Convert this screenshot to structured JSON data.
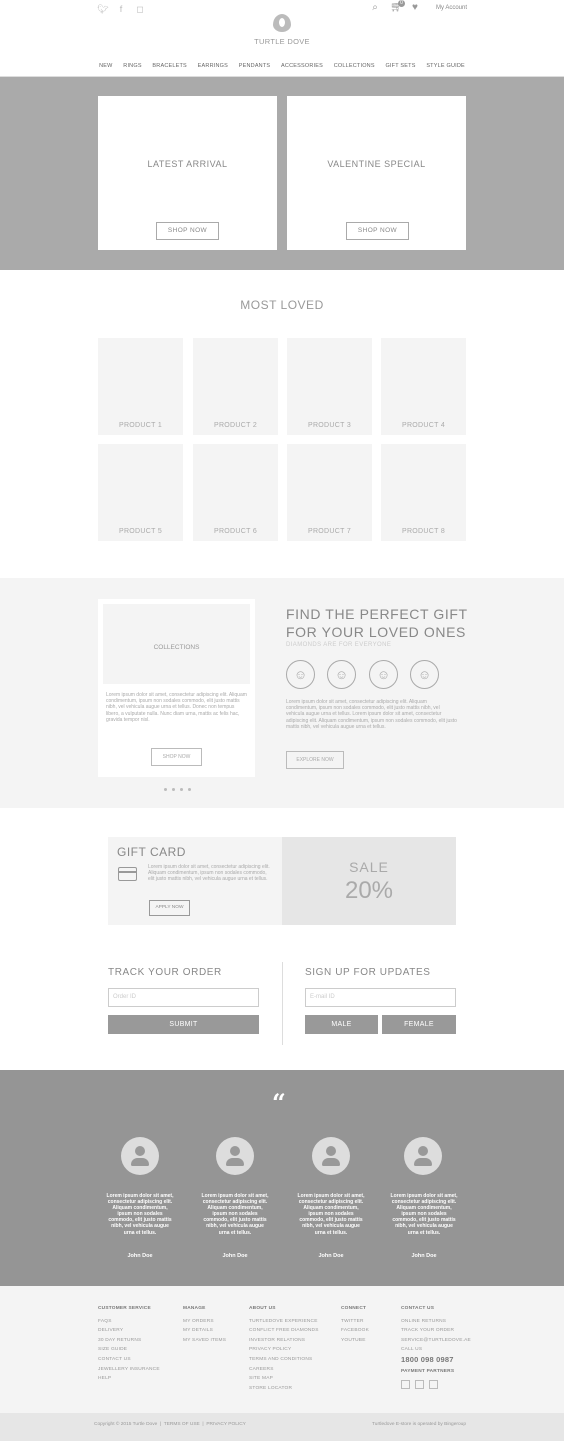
{
  "header": {
    "social": [
      "twitter-icon",
      "facebook-icon",
      "instagram-icon"
    ],
    "cart_count": "0",
    "my_account": "My Account",
    "brand": "TURTLE DOVE"
  },
  "nav": [
    "NEW",
    "RINGS",
    "BRACELETS",
    "EARRINGS",
    "PENDANTS",
    "ACCESSORIES",
    "COLLECTIONS",
    "GIFT SETS",
    "STYLE GUIDE"
  ],
  "hero": {
    "left": {
      "title": "LATEST ARRIVAL",
      "button": "SHOP NOW"
    },
    "right": {
      "title": "VALENTINE SPECIAL",
      "button": "SHOP NOW"
    }
  },
  "most_loved": {
    "title": "MOST LOVED",
    "products": [
      "PRODUCT 1",
      "PRODUCT 2",
      "PRODUCT 3",
      "PRODUCT 4",
      "PRODUCT 5",
      "PRODUCT 6",
      "PRODUCT 7",
      "PRODUCT 8"
    ]
  },
  "collections_card": {
    "label": "COLLECTIONS",
    "text": "Lorem ipsum dolor sit amet, consectetur adipiscing elit. Aliquam condimentum, ipsum non sodales commodo, elit justo mattis nibh, vel vehicula augue urna et tellus. Donec non tempus libero, a vulputate nulla. Nunc diam urna, mattis ac felis hac, gravida tempor nisl.",
    "button": "SHOP NOW"
  },
  "gift_finder": {
    "title_line1": "FIND THE PERFECT GIFT",
    "title_line2": "FOR YOUR LOVED ONES",
    "subtitle": "DIAMONDS ARE FOR EVERYONE",
    "text": "Lorem ipsum dolor sit amet, consectetur adipiscing elit. Aliquam condimentum, ipsum non sodales commodo, elit justo mattis nibh, vel vehicula augue urna et tellus. Lorem ipsum dolor sit amet, consectetur adipiscing elit. Aliquam condimentum, ipsum non sodales commodo, elit justo mattis nibh, vel vehicula augue urna et tellus.",
    "button": "EXPLORE NOW"
  },
  "gift_card": {
    "title": "GIFT CARD",
    "text": "Lorem ipsum dolor sit amet, consectetur adipiscing elit. Aliquam condimentum, ipsum non sodales commodo, elit justo mattis nibh, vel vehicula augue urna et tellus.",
    "button": "APPLY NOW"
  },
  "sale": {
    "label": "SALE",
    "value": "20%"
  },
  "track": {
    "title": "TRACK YOUR ORDER",
    "placeholder": "Order ID",
    "button": "SUBMIT"
  },
  "signup": {
    "title": "SIGN UP FOR UPDATES",
    "placeholder": "E-mail ID",
    "male": "MALE",
    "female": "FEMALE"
  },
  "testimonials": {
    "text": "Lorem ipsum dolor sit amet, consectetur adipiscing elit. Aliquam condimentum, ipsum non sodales commodo, elit justo mattis nibh, vel vehicula augue urna et tellus.",
    "name": "John Doe"
  },
  "footer": {
    "customer_service": {
      "title": "CUSTOMER SERVICE",
      "items": [
        "FAQS",
        "DELIVERY",
        "30 DAY RETURNS",
        "SIZE GUIDE",
        "CONTACT US",
        "JEWELLERY INSURANCE",
        "HELP"
      ]
    },
    "manage": {
      "title": "MANAGE",
      "items": [
        "MY ORDERS",
        "MY DETAILS",
        "MY SAVED ITEMS"
      ]
    },
    "about": {
      "title": "ABOUT US",
      "items": [
        "TURTLEDOVE EXPERIENCE",
        "CONFLICT FREE DIAMONDS",
        "INVESTOR RELATIONS",
        "PRIVACY POLICY",
        "TERMS AND CONDITIONS",
        "CAREERS",
        "SITE MAP",
        "STORE LOCATOR"
      ]
    },
    "connect": {
      "title": "CONNECT",
      "items": [
        "TWITTER",
        "FACEBOOK",
        "YOUTUBE"
      ]
    },
    "contact": {
      "title": "CONTACT US",
      "items": [
        "ONLINE RETURNS",
        "TRACK YOUR ORDER",
        "SERVICE@TURTLEDOVE.AE",
        "CALL US"
      ],
      "phone": "1800 098 0987",
      "payment": "PAYMENT PARTNERS"
    },
    "copyright": "Copyright © 2015 Turtle Dove",
    "terms": "TERMS OF USE",
    "privacy": "PRIVACY POLICY",
    "operated": "Turtledove E-store is operated by Bingeroup"
  }
}
